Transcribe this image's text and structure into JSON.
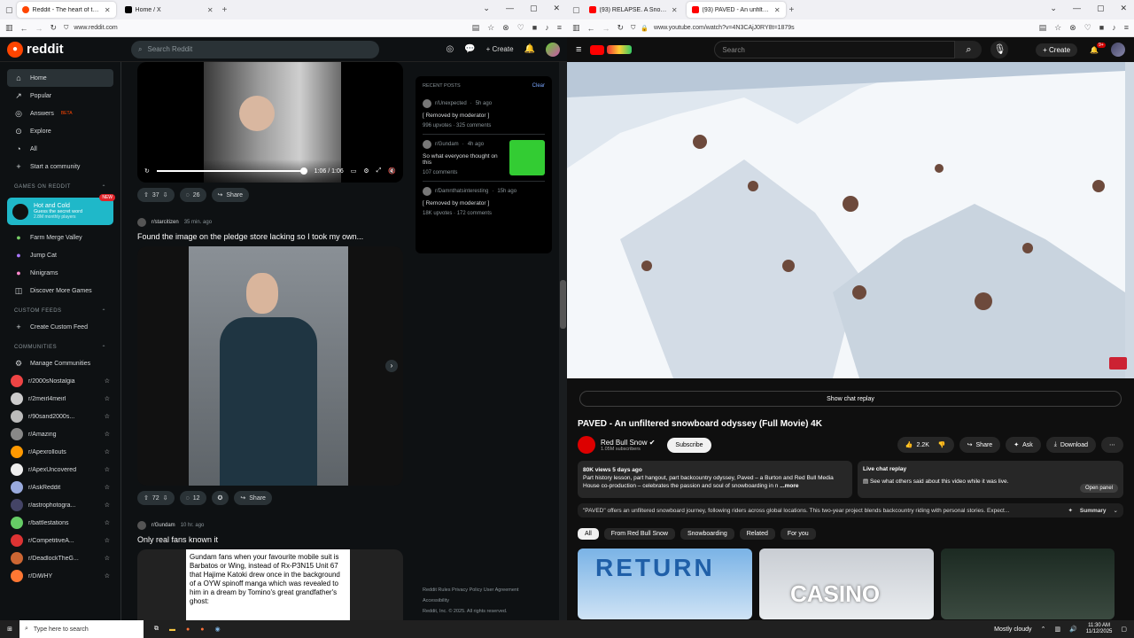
{
  "left_window": {
    "tabs": [
      {
        "title": "Reddit - The heart of the intern",
        "active": true,
        "color": "#ff4500"
      },
      {
        "title": "Home / X",
        "active": false,
        "color": "#000000"
      }
    ],
    "url": "www.reddit.com",
    "header": {
      "logo_text": "reddit",
      "search_placeholder": "Search Reddit",
      "create_label": "Create",
      "chat_badge": "1",
      "notif_badge": "9"
    },
    "sidebar": {
      "nav": [
        {
          "label": "Home",
          "icon": "home-icon"
        },
        {
          "label": "Popular",
          "icon": "popular-icon"
        },
        {
          "label": "Answers",
          "icon": "answers-icon",
          "badge": "BETA"
        },
        {
          "label": "Explore",
          "icon": "explore-icon"
        },
        {
          "label": "All",
          "icon": "all-icon"
        },
        {
          "label": "Start a community",
          "icon": "plus-icon"
        }
      ],
      "games_header": "GAMES ON REDDIT",
      "featured_game": {
        "title": "Hot and Cold",
        "subtitle": "Guess the secret word",
        "players": "2.8M monthly players",
        "badge": "NEW"
      },
      "games": [
        "Farm Merge Valley",
        "Jump Cat",
        "Ninigrams",
        "Discover More Games"
      ],
      "custom_header": "CUSTOM FEEDS",
      "create_feed": "Create Custom Feed",
      "communities_header": "COMMUNITIES",
      "manage": "Manage Communities",
      "communities": [
        "r/2000sNostalgia",
        "r/2meirl4meirl",
        "r/90sand2000s...",
        "r/Amazing",
        "r/Apexrollouts",
        "r/ApexUncovered",
        "r/AskReddit",
        "r/astrophotogra...",
        "r/battlestations",
        "r/CompetitiveA...",
        "r/DeadlockTheG...",
        "r/DiWHY"
      ]
    },
    "feed": {
      "video": {
        "time": "1:06 / 1:06",
        "progress": 1.0
      },
      "post1_actions": {
        "votes": "37",
        "comments": "26",
        "share": "Share"
      },
      "post2": {
        "sub": "r/starcitizen",
        "age": "35 min. ago",
        "title": "Found the image on the pledge store lacking so I took my own...",
        "votes": "72",
        "comments": "12",
        "share": "Share"
      },
      "post3": {
        "sub": "r/Gundam",
        "age": "10 hr. ago",
        "title": "Only real fans known it",
        "image_text": "Gundam fans when your favourite mobile suit is Barbatos or Wing, instead of Rx-P3N15 Unit 67 that Hajime Katoki drew once in the background of a OYW spinoff manga which was revealed to him in a dream by Tomino's great grandfather's ghost:"
      }
    },
    "recent": {
      "header": "RECENT POSTS",
      "clear": "Clear",
      "posts": [
        {
          "sub": "r/Unexpected",
          "age": "5h ago",
          "title": "[ Removed by moderator ]",
          "stats": "996 upvotes · 325 comments"
        },
        {
          "sub": "r/Gundam",
          "age": "4h ago",
          "title": "So what everyone thought on this",
          "stats": "107 comments"
        },
        {
          "sub": "r/Damnthatsinteresting",
          "age": "15h ago",
          "title": "[ Removed by moderator ]",
          "stats": "18K upvotes · 172 comments"
        }
      ]
    },
    "footer": {
      "links": "Reddit Rules   Privacy Policy   User Agreement",
      "access": "Accessibility",
      "copy": "Reddit, Inc. © 2025. All rights reserved."
    }
  },
  "right_window": {
    "tabs": [
      {
        "title": "(93) RELAPSE. A Snowboard Film",
        "active": false,
        "color": "#ff0000"
      },
      {
        "title": "(93) PAVED - An unfiltered snow",
        "active": true,
        "color": "#ff0000"
      }
    ],
    "url": "www.youtube.com/watch?v=4N3CAjJ0RY8t=1879s",
    "header": {
      "search_placeholder": "Search",
      "create": "Create",
      "notif_badge": "9+"
    },
    "chat_replay": "Show chat replay",
    "video_title": "PAVED - An unfiltered snowboard odyssey (Full Movie) 4K",
    "channel": {
      "name": "Red Bull Snow",
      "subs": "1.05M subscribers",
      "subscribe": "Subscribe"
    },
    "buttons": {
      "likes": "2.2K",
      "share": "Share",
      "ask": "Ask",
      "download": "Download"
    },
    "description": {
      "meta": "80K views  5 days ago",
      "text": "Part history lesson, part hangout, part backcountry odyssey, Paved – a Burton and Red Bull Media House co-production – celebrates the passion and soul of snowboarding in n",
      "more": "...more"
    },
    "live_chat": {
      "title": "Live chat replay",
      "text": "See what others said about this video while it was live.",
      "button": "Open panel"
    },
    "summary": {
      "text": "\"PAVED\" offers an unfiltered snowboard journey, following riders across global locations. This two-year project blends backcountry riding with personal stories. Expect...",
      "label": "Summary"
    },
    "chips": [
      "All",
      "From Red Bull Snow",
      "Snowboarding",
      "Related",
      "For you"
    ],
    "thumbs": [
      {
        "text": "RETURN"
      },
      {
        "text": "CASINO"
      },
      {
        "text": ""
      }
    ]
  },
  "taskbar": {
    "search": "Type here to search",
    "weather": "Mostly cloudy",
    "time": "11:30 AM",
    "date": "11/12/2025"
  }
}
